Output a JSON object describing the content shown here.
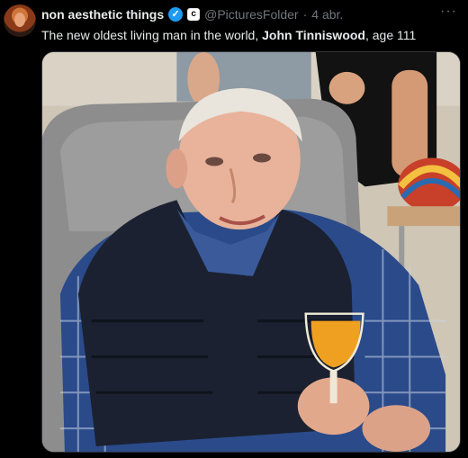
{
  "tweet": {
    "author_name": "non aesthetic things",
    "handle": "@PicturesFolder",
    "separator": "·",
    "date": "4 abr.",
    "more_label": "···",
    "verified_glyph": "✓",
    "affiliate_glyph": "c",
    "text_before": "The new oldest living man in the world, ",
    "text_bold": "John Tinniswood",
    "text_after": ", age 111"
  },
  "media": {
    "description_icon": "photo-icon",
    "colors": {
      "sweater": "#1b2130",
      "plaid": "#2a4a8a",
      "chair": "#8d8d8d",
      "juice": "#f0a020"
    }
  }
}
